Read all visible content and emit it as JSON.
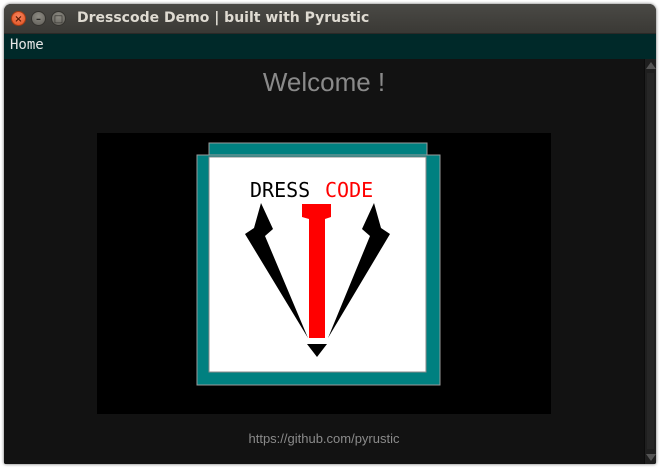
{
  "window": {
    "title": "Dresscode Demo | built with Pyrustic",
    "buttons": {
      "close_glyph": "×",
      "minimize_glyph": "–",
      "maximize_glyph": "□"
    }
  },
  "menubar": {
    "items": [
      {
        "label": "Home"
      }
    ]
  },
  "main": {
    "heading": "Welcome !",
    "logo": {
      "word_left": "DRESS",
      "word_right": "CODE",
      "colors": {
        "frame": "#008080",
        "background": "#ffffff",
        "word_left": "#000000",
        "word_right": "#ff0000",
        "tie": "#ff0000",
        "lapels": "#000000"
      }
    },
    "footer_link": "https://github.com/pyrustic"
  },
  "colors": {
    "window_bg": "#121212",
    "menubar_bg": "#002929",
    "titlebar_bg": "#3c3b37",
    "muted_text": "#8a8a8a"
  }
}
